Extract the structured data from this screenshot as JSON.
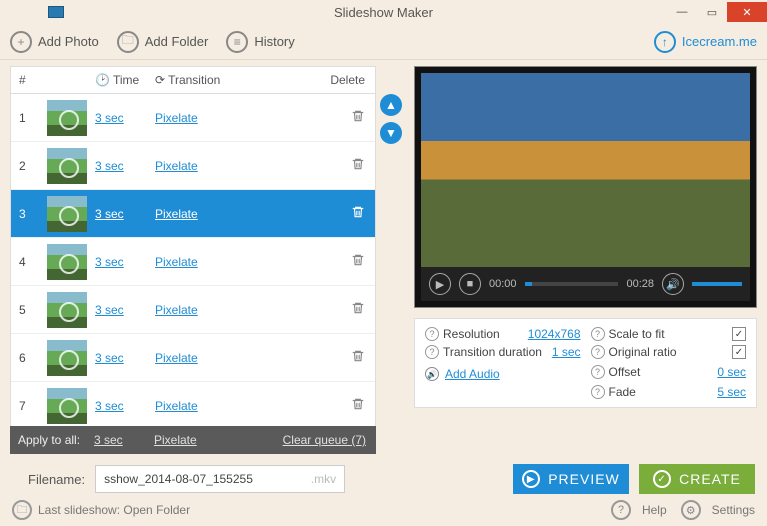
{
  "window": {
    "title": "Slideshow Maker"
  },
  "toolbar": {
    "add_photo": "Add Photo",
    "add_folder": "Add Folder",
    "history": "History",
    "brand": "Icecream.me"
  },
  "table": {
    "head": {
      "num": "#",
      "time": "Time",
      "transition": "Transition",
      "del": "Delete"
    },
    "rows": [
      {
        "n": "1",
        "time": "3 sec",
        "trans": "Pixelate",
        "sel": false
      },
      {
        "n": "2",
        "time": "3 sec",
        "trans": "Pixelate",
        "sel": false
      },
      {
        "n": "3",
        "time": "3 sec",
        "trans": "Pixelate",
        "sel": true
      },
      {
        "n": "4",
        "time": "3 sec",
        "trans": "Pixelate",
        "sel": false
      },
      {
        "n": "5",
        "time": "3 sec",
        "trans": "Pixelate",
        "sel": false
      },
      {
        "n": "6",
        "time": "3 sec",
        "trans": "Pixelate",
        "sel": false
      },
      {
        "n": "7",
        "time": "3 sec",
        "trans": "Pixelate",
        "sel": false
      }
    ],
    "apply": {
      "label": "Apply to all:",
      "time": "3 sec",
      "trans": "Pixelate",
      "clear": "Clear queue (7)"
    }
  },
  "player": {
    "cur": "00:00",
    "total": "00:28"
  },
  "settings": {
    "resolution_lbl": "Resolution",
    "resolution_val": "1024x768",
    "transdur_lbl": "Transition duration",
    "transdur_val": "1 sec",
    "scale_lbl": "Scale to fit",
    "scale_chk": true,
    "orig_lbl": "Original ratio",
    "orig_chk": true,
    "offset_lbl": "Offset",
    "offset_val": "0 sec",
    "fade_lbl": "Fade",
    "fade_val": "5 sec",
    "add_audio": "Add Audio"
  },
  "filename": {
    "label": "Filename:",
    "value": "sshow_2014-08-07_155255",
    "ext": ".mkv"
  },
  "buttons": {
    "preview": "PREVIEW",
    "create": "CREATE"
  },
  "footer": {
    "last": "Last slideshow: Open Folder",
    "help": "Help",
    "settings": "Settings"
  }
}
